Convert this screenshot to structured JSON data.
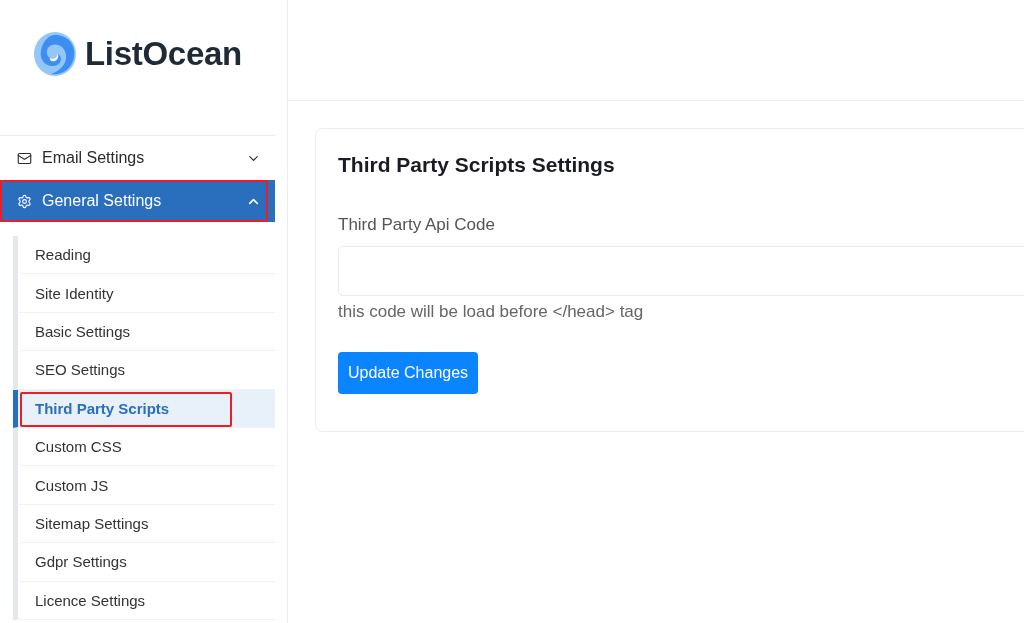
{
  "logo": {
    "name": "ListOcean"
  },
  "sidebar": {
    "items": [
      {
        "label": "Email Settings",
        "expanded": false,
        "selected": false,
        "highlighted": false
      },
      {
        "label": "General Settings",
        "expanded": true,
        "selected": true,
        "highlighted": true,
        "children": [
          {
            "label": "Reading",
            "selected": false,
            "highlighted": false
          },
          {
            "label": "Site Identity",
            "selected": false,
            "highlighted": false
          },
          {
            "label": "Basic Settings",
            "selected": false,
            "highlighted": false
          },
          {
            "label": "SEO Settings",
            "selected": false,
            "highlighted": false
          },
          {
            "label": "Third Party Scripts",
            "selected": true,
            "highlighted": true
          },
          {
            "label": "Custom CSS",
            "selected": false,
            "highlighted": false
          },
          {
            "label": "Custom JS",
            "selected": false,
            "highlighted": false
          },
          {
            "label": "Sitemap Settings",
            "selected": false,
            "highlighted": false
          },
          {
            "label": "Gdpr Settings",
            "selected": false,
            "highlighted": false
          },
          {
            "label": "Licence Settings",
            "selected": false,
            "highlighted": false
          }
        ]
      }
    ]
  },
  "content": {
    "title": "Third Party Scripts Settings",
    "fields": [
      {
        "label": "Third Party Api Code",
        "help": "this code will be load before </head> tag"
      }
    ],
    "button": "Update Changes"
  }
}
